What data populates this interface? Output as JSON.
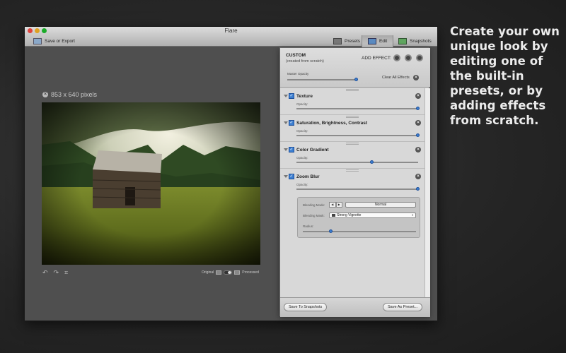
{
  "promo": {
    "text": "Create your own unique look by editing one of the built-in presets, or by adding effects from scratch."
  },
  "window": {
    "title": "Flare"
  },
  "toolbar": {
    "save_label": "Save or Export",
    "tabs": [
      {
        "label": "Presets",
        "icon": "presets-icon"
      },
      {
        "label": "Edit",
        "icon": "edit-icon",
        "selected": true
      },
      {
        "label": "Snapshots",
        "icon": "snapshots-icon"
      }
    ]
  },
  "image": {
    "dimensions": "853 x 640 pixels",
    "compare_left": "Original",
    "compare_right": "Processed"
  },
  "panel": {
    "title": "CUSTOM",
    "subtitle": "(created from scratch)",
    "add_effect_label": "ADD EFFECT:",
    "master_opacity_label": "Master Opacity",
    "master_opacity": 1.0,
    "clear_all_label": "Clear All Effects",
    "effects": [
      {
        "name": "Texture",
        "enabled": true,
        "opacity_label": "Opacity:",
        "opacity": 1.0
      },
      {
        "name": "Saturation, Brightness, Contrast",
        "enabled": true,
        "opacity_label": "Opacity:",
        "opacity": 1.0
      },
      {
        "name": "Color Gradient",
        "enabled": true,
        "opacity_label": "Opacity:",
        "opacity": 0.62
      },
      {
        "name": "Zoom Blur",
        "enabled": true,
        "opacity_label": "Opacity:",
        "opacity": 1.0
      }
    ],
    "zoom_blur_options": {
      "blending_mode_label": "Blending Mode:",
      "blending_mode": "Normal",
      "blending_mask_label": "Blending Mask:",
      "blending_mask": "Strong Vignette",
      "radius_label": "Radius:",
      "radius": 0.25
    },
    "save_snapshots_label": "Save To Snapshots",
    "save_preset_label": "Save As Preset..."
  },
  "colors": {
    "accent": "#3d7fd1",
    "panel_bg": "#d4d4d4",
    "app_bg": "#4f4f4f"
  }
}
